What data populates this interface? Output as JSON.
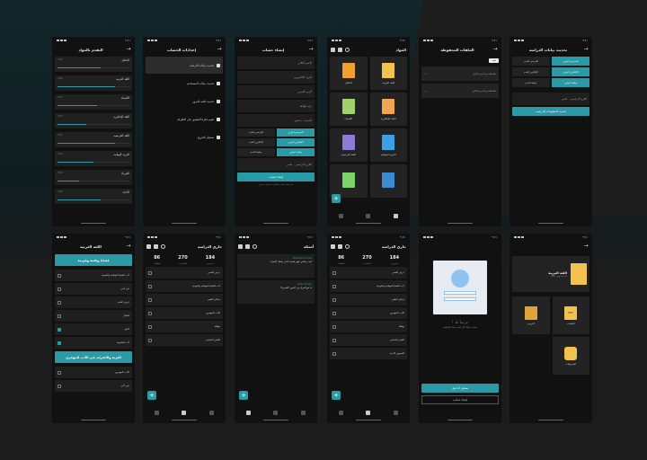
{
  "colors": {
    "accent": "#2a9aa6",
    "bg": "#1c1c1c",
    "card": "#232323"
  },
  "status": {
    "time": "٩:٤١",
    "signal": "📶"
  },
  "p1": {
    "title": "التقدم بالمواد",
    "items": [
      {
        "label": "التحليل",
        "pct": "%60",
        "fill": 0.6
      },
      {
        "label": "اللغة العربية",
        "pct": "%80",
        "fill": 0.8
      },
      {
        "label": "الكيمياء",
        "pct": "%55",
        "fill": 0.55
      },
      {
        "label": "اللغة الإنكليزية",
        "pct": "%40",
        "fill": 0.4
      },
      {
        "label": "اللغة الفرنسية",
        "pct": "%80",
        "fill": 0.8
      },
      {
        "label": "التربية الوطنية",
        "pct": "%50",
        "fill": 0.5
      },
      {
        "label": "الفيزياء",
        "pct": "%30",
        "fill": 0.3
      },
      {
        "label": "الأحياء",
        "pct": "%60",
        "fill": 0.6
      }
    ]
  },
  "p2": {
    "title": "إعدادات الحساب",
    "items": [
      {
        "label": "تحديث بيانات الدراسة",
        "icon": "book-icon"
      },
      {
        "label": "تحديث بيانات المستخدم",
        "icon": "user-icon"
      },
      {
        "label": "تحديث كلمة المرور",
        "icon": "lock-icon"
      },
      {
        "label": "تقييم فكرة التطبيق على التلغرام",
        "icon": "message-icon"
      },
      {
        "label": "تسجيل الخروج",
        "icon": "logout-icon"
      }
    ]
  },
  "p3": {
    "title": "إنشاء حساب",
    "fields": [
      "الاسم الثلاثي",
      "البريد الالكتروني",
      "الرمز السري",
      "رقم الهاتف",
      "المدينة - دمشق"
    ],
    "chips": [
      "الفرنسي أجباري",
      "الفرنسي الخدم",
      "الإنكليزي أجباري",
      "الإنكليزي الخدم",
      "وطنية أجباري",
      "وطنية الخدم"
    ],
    "branch": "الفرع الدراسي - علمي",
    "button": "إنشاء حساب",
    "footer": "هل لديك حساب بالفعل؟ تسجيل الدخول"
  },
  "p4": {
    "title": "المواد",
    "subjects": [
      "اللغة العربية",
      "التحليل",
      "اللغة الإنكليزية",
      "الكيمياء",
      "التربية الوطنية",
      "اللغة الفرنسية",
      "",
      ""
    ]
  },
  "p5": {
    "title": "الملفات المحفوظة",
    "notes": [
      {
        "text": "ملاحظة من الدرس الأول",
        "date": "----"
      },
      {
        "text": "ملاحظة من الدرس الثاني",
        "date": "----"
      }
    ],
    "badge": "ملف"
  },
  "p6": {
    "title": "تحديث بيانات الدراسة",
    "rows": [
      [
        "الفرنسي أجباري",
        "الفرنسي الخدم"
      ],
      [
        "الإنكليزي أجباري",
        "الإنكليزي الخدم"
      ],
      [
        "وطنية أجباري",
        "وطنية الخدم"
      ]
    ],
    "branch": "الفرع الدراسي - علمي",
    "button": "تحديث المعلومات الدراسية"
  },
  "p7": {
    "title": "اللغة العربية",
    "section1": "قضايا وطنية وقومية",
    "items1": [
      "أدب القضايا الوطنية والقومية",
      "نص أدبي",
      "عرض الشعر",
      "المقال",
      "النحو",
      "أدب المقاومة"
    ],
    "section2": "الغربة والاغتراب في الأدب المهجري",
    "items2": [
      "الأدب المهجري",
      "نص أدبي"
    ]
  },
  "p8": {
    "title": "جاري الدراسة",
    "stats": [
      {
        "n": "184",
        "l": "الدروس"
      },
      {
        "n": "270",
        "l": "الاختبارات"
      },
      {
        "n": "86",
        "l": "الملفات"
      }
    ],
    "rows": [
      "عرض الشعر",
      "أدب القضايا الوطنية والقومية",
      "مجالي الطبي",
      "الأدب المهجري",
      "توطئة",
      "الشعر العباسي"
    ]
  },
  "p9": {
    "title": "أسئلة",
    "questions": [
      {
        "user": "Mohamed Ahmed",
        "text": "كيف يمكنني فهم قصيدة النثر بشكل أفضل؟"
      },
      {
        "user": "Omar Hassan",
        "text": "ما هو الفرق بين البحور الشعرية؟"
      }
    ]
  },
  "p10": {
    "title": "جاري الدراسة",
    "stats": [
      {
        "n": "184",
        "l": "الدروس"
      },
      {
        "n": "270",
        "l": "الاختبارات"
      },
      {
        "n": "86",
        "l": "الملفات"
      }
    ],
    "rows": [
      "عرض الشعر",
      "أدب القضايا الوطنية والقومية",
      "مجالي الطبي",
      "الأدب المهجري",
      "توطئة",
      "الشعر العباسي",
      "النصوص الأدبية"
    ]
  },
  "p11": {
    "welcome": "مرحباً بك !",
    "sub": "سجل دخولك الآن لتبدأ رحلتك التعليمية",
    "login": "تسجيل الدخول",
    "signup": "إنشاء حساب"
  },
  "p12": {
    "title": "اللغة العربية",
    "subtitle": "عدد الدروس: 184",
    "cards": [
      "الملفات",
      "الدروس",
      "الفيديوهات"
    ],
    "pdf": "PDF"
  }
}
